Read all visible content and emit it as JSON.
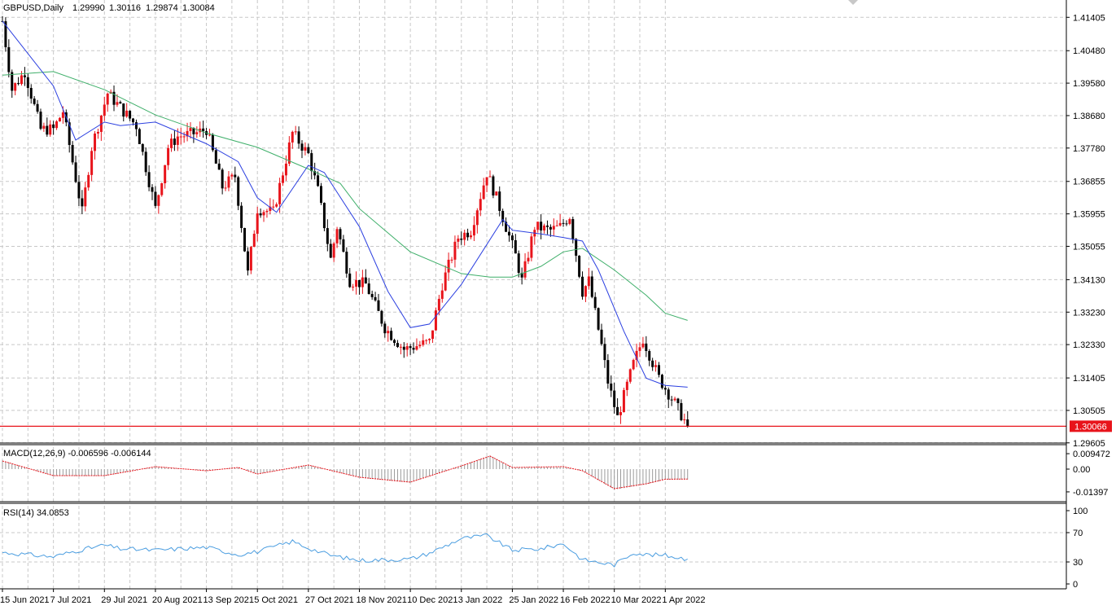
{
  "header": {
    "symbol": "GBPUSD,Daily",
    "open": "1.29990",
    "high": "1.30116",
    "low": "1.29874",
    "close": "1.30084"
  },
  "price_axis": {
    "ticks": [
      "1.41405",
      "1.40480",
      "1.39580",
      "1.38680",
      "1.37780",
      "1.36855",
      "1.35955",
      "1.35055",
      "1.34130",
      "1.33230",
      "1.32330",
      "1.31405",
      "1.30505",
      "1.29605"
    ],
    "current_price": "1.30066"
  },
  "macd": {
    "label": "MACD(12,26,9) -0.006596 -0.006144",
    "ticks": [
      "0.009472",
      "0.00",
      "-0.01397"
    ]
  },
  "rsi": {
    "label": "RSI(14) 34.0853",
    "ticks": [
      "100",
      "70",
      "30",
      "0"
    ]
  },
  "time_axis": {
    "labels": [
      "15 Jun 2021",
      "7 Jul 2021",
      "29 Jul 2021",
      "20 Aug 2021",
      "13 Sep 2021",
      "5 Oct 2021",
      "27 Oct 2021",
      "18 Nov 2021",
      "10 Dec 2021",
      "3 Jan 2022",
      "25 Jan 2022",
      "16 Feb 2022",
      "10 Mar 2022",
      "1 Apr 2022"
    ]
  },
  "colors": {
    "bull": "#e8141b",
    "bear": "#000000",
    "ma_fast": "#2b3fe0",
    "ma_slow": "#3faf6a",
    "price_line": "#e8141b",
    "macd_signal": "#e8141b",
    "macd_hist": "#9a9a9a",
    "rsi": "#4a9de0",
    "grid": "#c8c8c8"
  },
  "chart_data": {
    "type": "candlestick",
    "symbol": "GBPUSD",
    "timeframe": "Daily",
    "ylim": [
      1.296,
      1.4175
    ],
    "anchors": [
      [
        "15 Jun 2021",
        1.413
      ],
      [
        "18 Jun 2021",
        1.394
      ],
      [
        "24 Jun 2021",
        1.399
      ],
      [
        "1 Jul 2021",
        1.383
      ],
      [
        "7 Jul 2021",
        1.383
      ],
      [
        "12 Jul 2021",
        1.388
      ],
      [
        "20 Jul 2021",
        1.36
      ],
      [
        "23 Jul 2021",
        1.378
      ],
      [
        "30 Jul 2021",
        1.393
      ],
      [
        "5 Aug 2021",
        1.389
      ],
      [
        "12 Aug 2021",
        1.384
      ],
      [
        "20 Aug 2021",
        1.361
      ],
      [
        "26 Aug 2021",
        1.378
      ],
      [
        "31 Aug 2021",
        1.381
      ],
      [
        "8 Sep 2021",
        1.382
      ],
      [
        "13 Sep 2021",
        1.383
      ],
      [
        "20 Sep 2021",
        1.367
      ],
      [
        "24 Sep 2021",
        1.37
      ],
      [
        "30 Sep 2021",
        1.343
      ],
      [
        "5 Oct 2021",
        1.361
      ],
      [
        "12 Oct 2021",
        1.36
      ],
      [
        "20 Oct 2021",
        1.382
      ],
      [
        "27 Oct 2021",
        1.376
      ],
      [
        "1 Nov 2021",
        1.366
      ],
      [
        "5 Nov 2021",
        1.347
      ],
      [
        "9 Nov 2021",
        1.356
      ],
      [
        "15 Nov 2021",
        1.341
      ],
      [
        "22 Nov 2021",
        1.34
      ],
      [
        "30 Nov 2021",
        1.328
      ],
      [
        "8 Dec 2021",
        1.322
      ],
      [
        "14 Dec 2021",
        1.323
      ],
      [
        "20 Dec 2021",
        1.324
      ],
      [
        "24 Dec 2021",
        1.34
      ],
      [
        "31 Dec 2021",
        1.353
      ],
      [
        "6 Jan 2022",
        1.355
      ],
      [
        "13 Jan 2022",
        1.371
      ],
      [
        "18 Jan 2022",
        1.364
      ],
      [
        "26 Jan 2022",
        1.348
      ],
      [
        "28 Jan 2022",
        1.341
      ],
      [
        "3 Feb 2022",
        1.356
      ],
      [
        "10 Feb 2022",
        1.355
      ],
      [
        "15 Feb 2022",
        1.356
      ],
      [
        "18 Feb 2022",
        1.359
      ],
      [
        "24 Feb 2022",
        1.338
      ],
      [
        "28 Feb 2022",
        1.341
      ],
      [
        "4 Mar 2022",
        1.323
      ],
      [
        "8 Mar 2022",
        1.313
      ],
      [
        "11 Mar 2022",
        1.303
      ],
      [
        "14 Mar 2022",
        1.306
      ],
      [
        "18 Mar 2022",
        1.318
      ],
      [
        "23 Mar 2022",
        1.325
      ],
      [
        "30 Mar 2022",
        1.314
      ],
      [
        "6 Apr 2022",
        1.307
      ],
      [
        "12 Apr 2022",
        1.3007
      ]
    ],
    "ma_fast": [
      [
        "15 Jun 2021",
        1.413
      ],
      [
        "7 Jul 2021",
        1.395
      ],
      [
        "16 Jul 2021",
        1.38
      ],
      [
        "29 Jul 2021",
        1.385
      ],
      [
        "5 Aug 2021",
        1.384
      ],
      [
        "20 Aug 2021",
        1.385
      ],
      [
        "13 Sep 2021",
        1.379
      ],
      [
        "27 Sep 2021",
        1.374
      ],
      [
        "5 Oct 2021",
        1.364
      ],
      [
        "13 Oct 2021",
        1.36
      ],
      [
        "27 Oct 2021",
        1.373
      ],
      [
        "3 Nov 2021",
        1.371
      ],
      [
        "18 Nov 2021",
        1.356
      ],
      [
        "1 Dec 2021",
        1.338
      ],
      [
        "10 Dec 2021",
        1.328
      ],
      [
        "20 Dec 2021",
        1.329
      ],
      [
        "3 Jan 2022",
        1.34
      ],
      [
        "20 Jan 2022",
        1.358
      ],
      [
        "25 Jan 2022",
        1.355
      ],
      [
        "7 Feb 2022",
        1.354
      ],
      [
        "16 Feb 2022",
        1.353
      ],
      [
        "24 Feb 2022",
        1.352
      ],
      [
        "3 Mar 2022",
        1.344
      ],
      [
        "15 Mar 2022",
        1.327
      ],
      [
        "24 Mar 2022",
        1.314
      ],
      [
        "1 Apr 2022",
        1.312
      ],
      [
        "12 Apr 2022",
        1.3115
      ]
    ],
    "ma_slow": [
      [
        "15 Jun 2021",
        1.398
      ],
      [
        "7 Jul 2021",
        1.399
      ],
      [
        "29 Jul 2021",
        1.394
      ],
      [
        "20 Aug 2021",
        1.387
      ],
      [
        "13 Sep 2021",
        1.382
      ],
      [
        "5 Oct 2021",
        1.378
      ],
      [
        "27 Oct 2021",
        1.372
      ],
      [
        "10 Nov 2021",
        1.368
      ],
      [
        "18 Nov 2021",
        1.361
      ],
      [
        "10 Dec 2021",
        1.349
      ],
      [
        "3 Jan 2022",
        1.343
      ],
      [
        "14 Jan 2022",
        1.342
      ],
      [
        "25 Jan 2022",
        1.342
      ],
      [
        "7 Feb 2022",
        1.345
      ],
      [
        "16 Feb 2022",
        1.349
      ],
      [
        "24 Feb 2022",
        1.35
      ],
      [
        "10 Mar 2022",
        1.344
      ],
      [
        "24 Mar 2022",
        1.337
      ],
      [
        "1 Apr 2022",
        1.332
      ],
      [
        "12 Apr 2022",
        1.33
      ]
    ],
    "macd_signal": [
      [
        "15 Jun 2021",
        0.005
      ],
      [
        "7 Jul 2021",
        -0.004
      ],
      [
        "29 Jul 2021",
        -0.004
      ],
      [
        "20 Aug 2021",
        0.0015
      ],
      [
        "13 Sep 2021",
        -0.001
      ],
      [
        "27 Sep 2021",
        0.001
      ],
      [
        "5 Oct 2021",
        -0.003
      ],
      [
        "27 Oct 2021",
        0.0025
      ],
      [
        "18 Nov 2021",
        -0.005
      ],
      [
        "10 Dec 2021",
        -0.008
      ],
      [
        "3 Jan 2022",
        0.002
      ],
      [
        "14 Jan 2022",
        0.008
      ],
      [
        "25 Jan 2022",
        0.001
      ],
      [
        "16 Feb 2022",
        0.0015
      ],
      [
        "24 Feb 2022",
        -0.001
      ],
      [
        "10 Mar 2022",
        -0.012
      ],
      [
        "24 Mar 2022",
        -0.009
      ],
      [
        "1 Apr 2022",
        -0.0062
      ],
      [
        "12 Apr 2022",
        -0.0061
      ]
    ],
    "rsi": [
      [
        "15 Jun 2021",
        43
      ],
      [
        "7 Jul 2021",
        37
      ],
      [
        "16 Jul 2021",
        45
      ],
      [
        "29 Jul 2021",
        53
      ],
      [
        "5 Aug 2021",
        48
      ],
      [
        "20 Aug 2021",
        46
      ],
      [
        "13 Sep 2021",
        50
      ],
      [
        "27 Sep 2021",
        40
      ],
      [
        "5 Oct 2021",
        44
      ],
      [
        "20 Oct 2021",
        58
      ],
      [
        "27 Oct 2021",
        49
      ],
      [
        "5 Nov 2021",
        39
      ],
      [
        "18 Nov 2021",
        32
      ],
      [
        "10 Dec 2021",
        34
      ],
      [
        "20 Dec 2021",
        42
      ],
      [
        "3 Jan 2022",
        62
      ],
      [
        "13 Jan 2022",
        66
      ],
      [
        "25 Jan 2022",
        46
      ],
      [
        "7 Feb 2022",
        48
      ],
      [
        "16 Feb 2022",
        55
      ],
      [
        "24 Feb 2022",
        33
      ],
      [
        "10 Mar 2022",
        26
      ],
      [
        "18 Mar 2022",
        43
      ],
      [
        "24 Mar 2022",
        40
      ],
      [
        "1 Apr 2022",
        39
      ],
      [
        "12 Apr 2022",
        34
      ]
    ]
  }
}
